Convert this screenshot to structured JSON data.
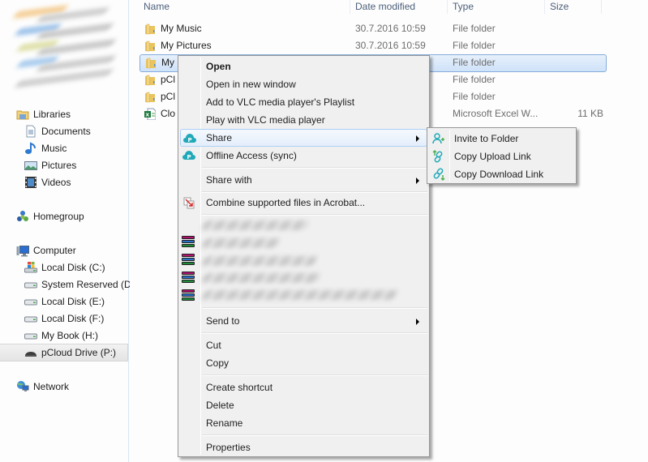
{
  "nav": {
    "libraries": {
      "label": "Libraries",
      "children": [
        {
          "label": "Documents",
          "icon": "documents-icon"
        },
        {
          "label": "Music",
          "icon": "music-icon"
        },
        {
          "label": "Pictures",
          "icon": "pictures-icon"
        },
        {
          "label": "Videos",
          "icon": "videos-icon"
        }
      ]
    },
    "homegroup": {
      "label": "Homegroup"
    },
    "computer": {
      "label": "Computer",
      "children": [
        {
          "label": "Local Disk (C:)",
          "icon": "windows-drive-icon"
        },
        {
          "label": "System Reserved (D:)",
          "icon": "drive-icon"
        },
        {
          "label": "Local Disk (E:)",
          "icon": "drive-icon"
        },
        {
          "label": "Local Disk (F:)",
          "icon": "drive-icon"
        },
        {
          "label": "My Book (H:)",
          "icon": "drive-icon"
        },
        {
          "label": "pCloud Drive (P:)",
          "icon": "network-drive-icon",
          "selected": true
        }
      ]
    },
    "network": {
      "label": "Network"
    }
  },
  "list": {
    "columns": {
      "name": "Name",
      "date": "Date modified",
      "type": "Type",
      "size": "Size"
    },
    "rows": [
      {
        "name": "My Music",
        "date": "30.7.2016 10:59",
        "type": "File folder",
        "size": "",
        "icon": "folder-icon"
      },
      {
        "name": "My Pictures",
        "date": "30.7.2016 10:59",
        "type": "File folder",
        "size": "",
        "icon": "folder-icon"
      },
      {
        "name": "My",
        "date": "",
        "type": "File folder",
        "size": "",
        "icon": "folder-icon",
        "selected": true
      },
      {
        "name": "pCl",
        "date": "",
        "type": "File folder",
        "size": "",
        "icon": "folder-icon"
      },
      {
        "name": "pCl",
        "date": "",
        "type": "File folder",
        "size": "",
        "icon": "folder-icon"
      },
      {
        "name": "Clo",
        "date": "",
        "type": "Microsoft Excel W...",
        "size": "11 KB",
        "icon": "excel-icon"
      }
    ]
  },
  "context_menu": {
    "items": {
      "open": "Open",
      "open_new_window": "Open in new window",
      "vlc_playlist": "Add to VLC media player's Playlist",
      "vlc_play": "Play with VLC media player",
      "share": "Share",
      "offline_access": "Offline Access (sync)",
      "share_with": "Share with",
      "acrobat": "Combine supported files in Acrobat...",
      "send_to": "Send to",
      "cut": "Cut",
      "copy": "Copy",
      "create_shortcut": "Create shortcut",
      "delete": "Delete",
      "rename": "Rename",
      "properties": "Properties"
    },
    "hovered": "Share"
  },
  "share_submenu": {
    "items": [
      {
        "label": "Invite to Folder",
        "icon": "invite-user-icon"
      },
      {
        "label": "Copy Upload Link",
        "icon": "upload-link-icon"
      },
      {
        "label": "Copy Download Link",
        "icon": "download-link-icon"
      }
    ]
  },
  "colors": {
    "selection_border": "#84acdd",
    "selection_fill": "#cfe2f9",
    "menu_bg": "#f0f0f0",
    "pcloud_teal": "#20a9b8",
    "header_text": "#4c607a"
  }
}
